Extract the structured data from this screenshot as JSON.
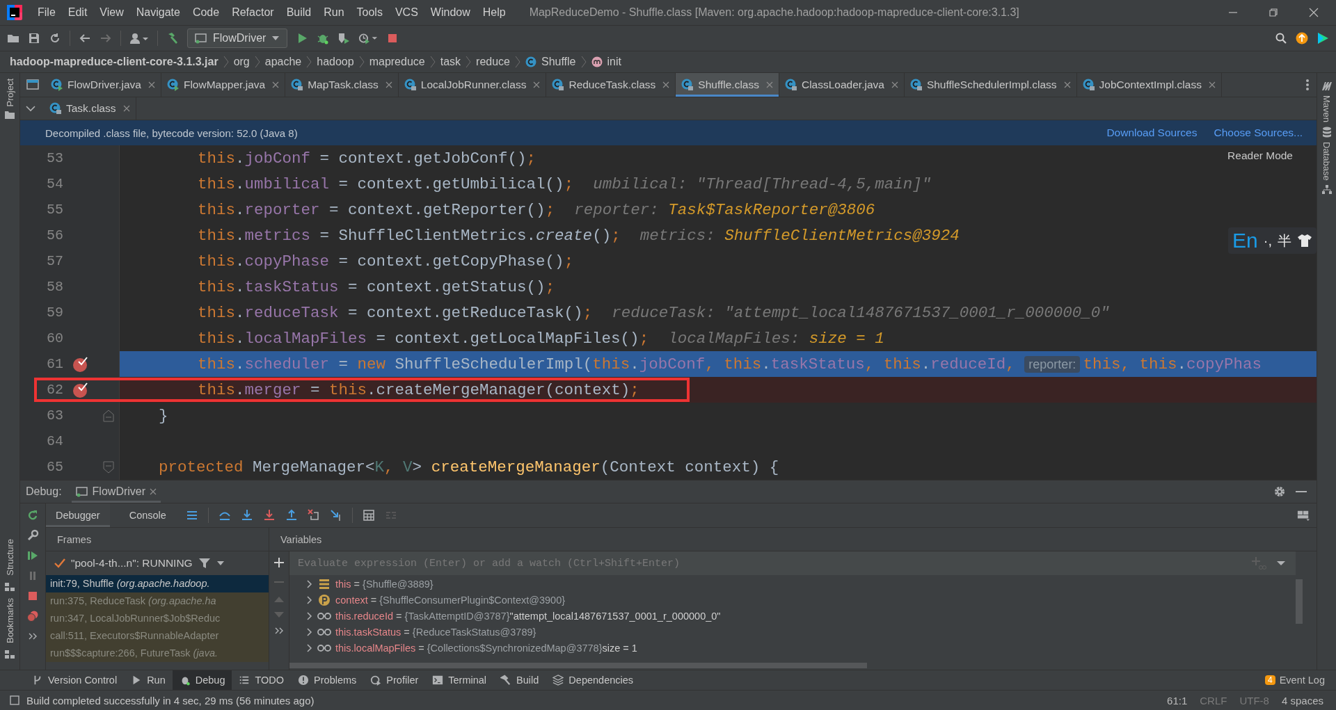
{
  "window": {
    "title": "MapReduceDemo - Shuffle.class [Maven: org.apache.hadoop:hadoop-mapreduce-client-core:3.1.3]"
  },
  "menu": [
    "File",
    "Edit",
    "View",
    "Navigate",
    "Code",
    "Refactor",
    "Build",
    "Run",
    "Tools",
    "VCS",
    "Window",
    "Help"
  ],
  "toolbar": {
    "run_configuration": "FlowDriver"
  },
  "breadcrumbs": [
    {
      "label": "hadoop-mapreduce-client-core-3.1.3.jar",
      "kind": "archive"
    },
    {
      "label": "org",
      "kind": "package"
    },
    {
      "label": "apache",
      "kind": "package"
    },
    {
      "label": "hadoop",
      "kind": "package"
    },
    {
      "label": "mapreduce",
      "kind": "package"
    },
    {
      "label": "task",
      "kind": "package"
    },
    {
      "label": "reduce",
      "kind": "package"
    },
    {
      "label": "Shuffle",
      "kind": "class"
    },
    {
      "label": "init",
      "kind": "method"
    }
  ],
  "left_tool_strip": {
    "top": [
      "Project"
    ],
    "bottom": [
      "Structure",
      "Bookmarks"
    ]
  },
  "right_tool_strip": [
    "Maven",
    "Database"
  ],
  "editor_tabs": [
    {
      "label": "FlowDriver.java",
      "kind": "java",
      "selected": false
    },
    {
      "label": "FlowMapper.java",
      "kind": "java",
      "selected": false
    },
    {
      "label": "MapTask.class",
      "kind": "class",
      "selected": false
    },
    {
      "label": "LocalJobRunner.class",
      "kind": "class",
      "selected": false
    },
    {
      "label": "ReduceTask.class",
      "kind": "class",
      "selected": false
    },
    {
      "label": "Shuffle.class",
      "kind": "class",
      "selected": true
    },
    {
      "label": "ClassLoader.java",
      "kind": "class",
      "selected": false
    },
    {
      "label": "ShuffleSchedulerImpl.class",
      "kind": "class",
      "selected": false
    },
    {
      "label": "JobContextImpl.class",
      "kind": "class",
      "selected": false
    }
  ],
  "editor_tabs_row_2": [
    {
      "label": "Task.class",
      "kind": "class",
      "selected": false
    }
  ],
  "banner": {
    "text": "Decompiled .class file, bytecode version: 52.0 (Java 8)",
    "links": [
      "Download Sources",
      "Choose Sources..."
    ]
  },
  "reader_mode": "Reader Mode",
  "code_lines": [
    {
      "number": "53",
      "kind": "statement",
      "breakpoint": false,
      "current": false,
      "outlined": false,
      "tokens": [
        {
          "kind": "kw",
          "text": "this"
        },
        {
          "kind": "plain",
          "text": "."
        },
        {
          "kind": "field",
          "text": "jobConf"
        },
        {
          "kind": "plain",
          "text": " = context.getJobConf()"
        },
        {
          "kind": "kw",
          "text": ";"
        }
      ]
    },
    {
      "number": "54",
      "kind": "statement",
      "breakpoint": false,
      "current": false,
      "outlined": false,
      "tokens": [
        {
          "kind": "kw",
          "text": "this"
        },
        {
          "kind": "plain",
          "text": "."
        },
        {
          "kind": "field",
          "text": "umbilical"
        },
        {
          "kind": "plain",
          "text": " = context.getUmbilical()"
        },
        {
          "kind": "kw",
          "text": ";"
        }
      ],
      "hint": {
        "label": "umbilical:",
        "value": "\"Thread[Thread-4,5,main]\"",
        "kind": "string"
      }
    },
    {
      "number": "55",
      "kind": "statement",
      "breakpoint": false,
      "current": false,
      "outlined": false,
      "tokens": [
        {
          "kind": "kw",
          "text": "this"
        },
        {
          "kind": "plain",
          "text": "."
        },
        {
          "kind": "field",
          "text": "reporter"
        },
        {
          "kind": "plain",
          "text": " = context.getReporter()"
        },
        {
          "kind": "kw",
          "text": ";"
        }
      ],
      "hint": {
        "label": "reporter:",
        "value": "Task$TaskReporter@3806",
        "kind": "object"
      }
    },
    {
      "number": "56",
      "kind": "statement",
      "breakpoint": false,
      "current": false,
      "outlined": false,
      "tokens": [
        {
          "kind": "kw",
          "text": "this"
        },
        {
          "kind": "plain",
          "text": "."
        },
        {
          "kind": "field",
          "text": "metrics"
        },
        {
          "kind": "plain",
          "text": " = ShuffleClientMetrics."
        },
        {
          "kind": "italic",
          "text": "create"
        },
        {
          "kind": "plain",
          "text": "()"
        },
        {
          "kind": "kw",
          "text": ";"
        }
      ],
      "hint": {
        "label": "metrics:",
        "value": "ShuffleClientMetrics@3924",
        "kind": "object"
      }
    },
    {
      "number": "57",
      "kind": "statement",
      "breakpoint": false,
      "current": false,
      "outlined": false,
      "tokens": [
        {
          "kind": "kw",
          "text": "this"
        },
        {
          "kind": "plain",
          "text": "."
        },
        {
          "kind": "field",
          "text": "copyPhase"
        },
        {
          "kind": "plain",
          "text": " = context.getCopyPhase()"
        },
        {
          "kind": "kw",
          "text": ";"
        }
      ]
    },
    {
      "number": "58",
      "kind": "statement",
      "breakpoint": false,
      "current": false,
      "outlined": false,
      "tokens": [
        {
          "kind": "kw",
          "text": "this"
        },
        {
          "kind": "plain",
          "text": "."
        },
        {
          "kind": "field",
          "text": "taskStatus"
        },
        {
          "kind": "plain",
          "text": " = context.getStatus()"
        },
        {
          "kind": "kw",
          "text": ";"
        }
      ]
    },
    {
      "number": "59",
      "kind": "statement",
      "breakpoint": false,
      "current": false,
      "outlined": false,
      "tokens": [
        {
          "kind": "kw",
          "text": "this"
        },
        {
          "kind": "plain",
          "text": "."
        },
        {
          "kind": "field",
          "text": "reduceTask"
        },
        {
          "kind": "plain",
          "text": " = context.getReduceTask()"
        },
        {
          "kind": "kw",
          "text": ";"
        }
      ],
      "hint": {
        "label": "reduceTask:",
        "value": "\"attempt_local1487671537_0001_r_000000_0\"",
        "kind": "string"
      }
    },
    {
      "number": "60",
      "kind": "statement",
      "breakpoint": false,
      "current": false,
      "outlined": false,
      "tokens": [
        {
          "kind": "kw",
          "text": "this"
        },
        {
          "kind": "plain",
          "text": "."
        },
        {
          "kind": "field",
          "text": "localMapFiles"
        },
        {
          "kind": "plain",
          "text": " = context.getLocalMapFiles()"
        },
        {
          "kind": "kw",
          "text": ";"
        }
      ],
      "hint": {
        "label": "localMapFiles:",
        "value": "size = 1",
        "kind": "object"
      }
    },
    {
      "number": "61",
      "kind": "statement",
      "breakpoint": true,
      "current": true,
      "outlined": false,
      "tokens": [
        {
          "kind": "kw",
          "text": "this"
        },
        {
          "kind": "plain",
          "text": "."
        },
        {
          "kind": "field",
          "text": "scheduler"
        },
        {
          "kind": "plain",
          "text": " = "
        },
        {
          "kind": "kw",
          "text": "new"
        },
        {
          "kind": "plain",
          "text": " ShuffleSchedulerImpl("
        },
        {
          "kind": "kw",
          "text": "this"
        },
        {
          "kind": "plain",
          "text": "."
        },
        {
          "kind": "field",
          "text": "jobConf"
        },
        {
          "kind": "kw",
          "text": ", this"
        },
        {
          "kind": "plain",
          "text": "."
        },
        {
          "kind": "field",
          "text": "taskStatus"
        },
        {
          "kind": "kw",
          "text": ", this"
        },
        {
          "kind": "plain",
          "text": "."
        },
        {
          "kind": "field",
          "text": "reduceId"
        },
        {
          "kind": "kw",
          "text": ", "
        },
        {
          "kind": "chip",
          "text": "reporter:"
        },
        {
          "kind": "kw",
          "text": "this, this"
        },
        {
          "kind": "plain",
          "text": "."
        },
        {
          "kind": "field",
          "text": "copyPhas"
        }
      ]
    },
    {
      "number": "62",
      "kind": "statement",
      "breakpoint": true,
      "current": false,
      "outlined": true,
      "tokens": [
        {
          "kind": "kw",
          "text": "this"
        },
        {
          "kind": "plain",
          "text": "."
        },
        {
          "kind": "field",
          "text": "merger"
        },
        {
          "kind": "plain",
          "text": " = "
        },
        {
          "kind": "kw",
          "text": "this"
        },
        {
          "kind": "plain",
          "text": ".createMergeManager(context)"
        },
        {
          "kind": "kw",
          "text": ";"
        }
      ]
    },
    {
      "number": "63",
      "kind": "member",
      "breakpoint": false,
      "current": false,
      "outlined": false,
      "fold": {
        "kind": "end"
      },
      "tokens": [
        {
          "kind": "plain",
          "text": "}"
        }
      ]
    },
    {
      "number": "64",
      "kind": "blank",
      "breakpoint": false,
      "current": false,
      "outlined": false
    },
    {
      "number": "65",
      "kind": "member",
      "breakpoint": false,
      "current": false,
      "outlined": false,
      "fold": {
        "kind": "start"
      },
      "tokens": [
        {
          "kind": "kw",
          "text": "protected"
        },
        {
          "kind": "plain",
          "text": " MergeManager<"
        },
        {
          "kind": "generic",
          "text": "K"
        },
        {
          "kind": "kw",
          "text": ", "
        },
        {
          "kind": "generic",
          "text": "V"
        },
        {
          "kind": "plain",
          "text": "> "
        },
        {
          "kind": "decl",
          "text": "createMergeManager"
        },
        {
          "kind": "plain",
          "text": "(Context context) {"
        }
      ]
    }
  ],
  "ime_toolbar": {
    "language": "En",
    "punctuation": "·,",
    "width": "半"
  },
  "debug": {
    "title": "Debug:",
    "session_tab": "FlowDriver",
    "tabs": [
      {
        "label": "Debugger",
        "selected": true
      },
      {
        "label": "Console",
        "selected": false
      }
    ],
    "frames": {
      "title": "Frames",
      "thread": "\"pool-4-th...n\": RUNNING",
      "items": [
        {
          "text": "init:79, Shuffle *(org.apache.hadoop.*",
          "selected": true,
          "library": false
        },
        {
          "text": "run:375, ReduceTask *(org.apache.ha*",
          "selected": false,
          "library": true
        },
        {
          "text": "run:347, LocalJobRunner$Job$Reduc",
          "selected": false,
          "library": true
        },
        {
          "text": "call:511, Executors$RunnableAdapter",
          "selected": false,
          "library": true
        },
        {
          "text": "run$$$capture:266, FutureTask *(java.*",
          "selected": false,
          "library": true
        }
      ]
    },
    "variables": {
      "title": "Variables",
      "placeholder": "Evaluate expression (Enter) or add a watch (Ctrl+Shift+Enter)",
      "items": [
        {
          "kind": "object",
          "name": "this",
          "operator": "=",
          "value": "{Shuffle@3889}"
        },
        {
          "kind": "param",
          "name": "context",
          "operator": "=",
          "value": "{ShuffleConsumerPlugin$Context@3900}"
        },
        {
          "kind": "watch",
          "name": "this.reduceId",
          "operator": "=",
          "value": "{TaskAttemptID@3787}",
          "extra": "\"attempt_local1487671537_0001_r_000000_0\""
        },
        {
          "kind": "watch",
          "name": "this.taskStatus",
          "operator": "=",
          "value": "{ReduceTaskStatus@3789}"
        },
        {
          "kind": "watch",
          "name": "this.localMapFiles",
          "operator": "=",
          "value": "{Collections$SynchronizedMap@3778}",
          "extra": "size = 1"
        }
      ]
    }
  },
  "tool_window_tabs": [
    {
      "label": "Version Control",
      "kind": "vcs",
      "selected": false
    },
    {
      "label": "Run",
      "kind": "run",
      "selected": false
    },
    {
      "label": "Debug",
      "kind": "debug",
      "selected": true
    },
    {
      "label": "TODO",
      "kind": "todo",
      "selected": false
    },
    {
      "label": "Problems",
      "kind": "problems",
      "selected": false
    },
    {
      "label": "Profiler",
      "kind": "profiler",
      "selected": false
    },
    {
      "label": "Terminal",
      "kind": "terminal",
      "selected": false
    },
    {
      "label": "Build",
      "kind": "build",
      "selected": false
    },
    {
      "label": "Dependencies",
      "kind": "dependencies",
      "selected": false
    }
  ],
  "event_log": {
    "count": "4",
    "label": "Event Log"
  },
  "status_bar": {
    "message": "Build completed successfully in 4 sec, 29 ms (56 minutes ago)",
    "position": "61:1",
    "line_separator": "CRLF",
    "encoding": "UTF-8",
    "indent": "4 spaces"
  }
}
